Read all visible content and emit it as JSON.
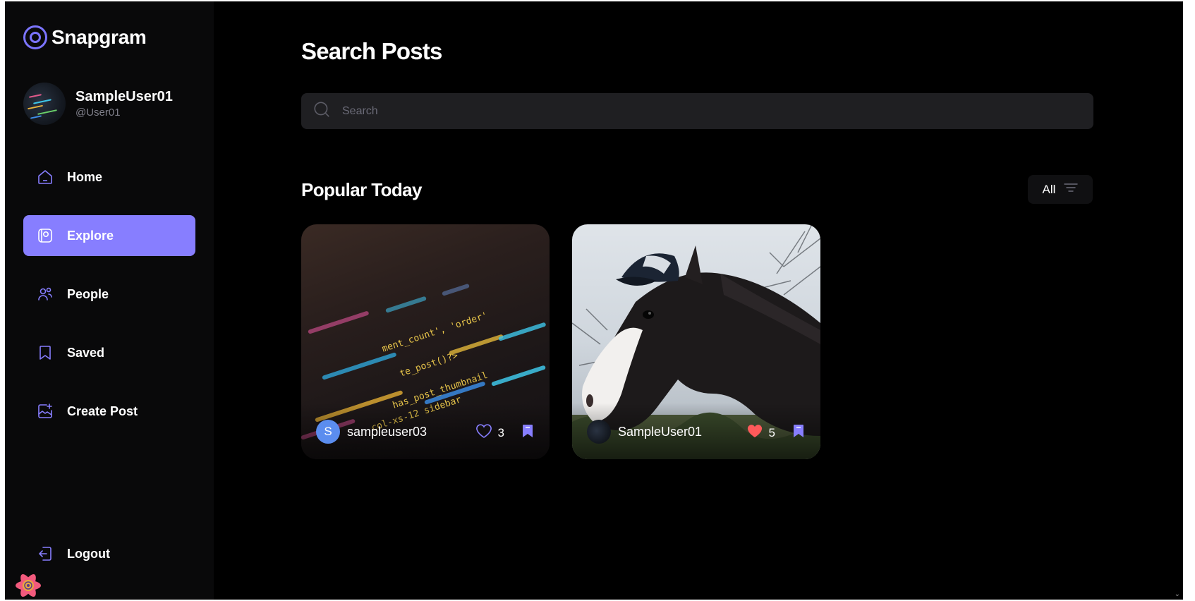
{
  "app": {
    "name": "Snapgram"
  },
  "profile": {
    "name": "SampleUser01",
    "handle": "@User01"
  },
  "nav": [
    {
      "label": "Home",
      "icon": "home-icon",
      "active": false
    },
    {
      "label": "Explore",
      "icon": "explore-icon",
      "active": true
    },
    {
      "label": "People",
      "icon": "people-icon",
      "active": false
    },
    {
      "label": "Saved",
      "icon": "saved-icon",
      "active": false
    },
    {
      "label": "Create Post",
      "icon": "create-post-icon",
      "active": false
    }
  ],
  "logout": {
    "label": "Logout",
    "icon": "logout-icon"
  },
  "page": {
    "title": "Search Posts"
  },
  "search": {
    "placeholder": "Search",
    "value": ""
  },
  "section": {
    "title": "Popular Today"
  },
  "filter": {
    "label": "All",
    "icon": "filter-icon"
  },
  "posts": [
    {
      "image": "code-screen",
      "user_initial": "S",
      "username": "sampleuser03",
      "likes": "3",
      "liked": false,
      "saved": true
    },
    {
      "image": "horse-with-cap",
      "user_initial": "",
      "username": "SampleUser01",
      "likes": "5",
      "liked": true,
      "saved": true
    }
  ],
  "colors": {
    "accent": "#877eff",
    "background": "#000000",
    "sidebar": "#09090a",
    "input": "#1f1f22",
    "like": "#ff5a5a",
    "avatar_blue": "#5b8def"
  }
}
